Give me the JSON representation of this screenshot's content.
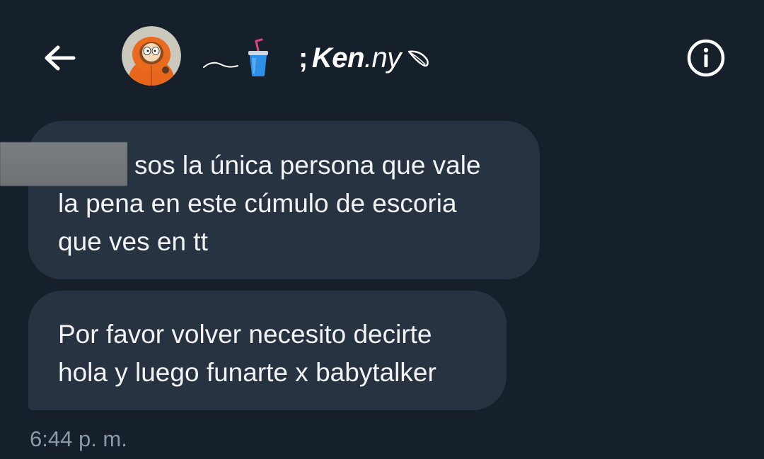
{
  "header": {
    "name_prefix": ";",
    "name_bold": "Ken",
    "name_rest": ".ny",
    "back_icon": "arrow-left-icon",
    "info_icon": "info-circle-icon",
    "decorations": [
      "swoosh-icon",
      "cup-with-straw-icon",
      "leaf-icon"
    ]
  },
  "messages": [
    {
      "lines": [
        "sos la única persona que vale",
        "la pena en este cúmulo de escoria",
        "que ves en tt"
      ],
      "redacted": true
    },
    {
      "lines": [
        "Por favor volver necesito decirte",
        "hola y luego funarte x babytalker"
      ]
    }
  ],
  "timestamp": "6:44 p. m.",
  "colors": {
    "background": "#15202b",
    "bubble": "#273340",
    "text": "#f1f3f4",
    "muted": "#8b98a5"
  }
}
